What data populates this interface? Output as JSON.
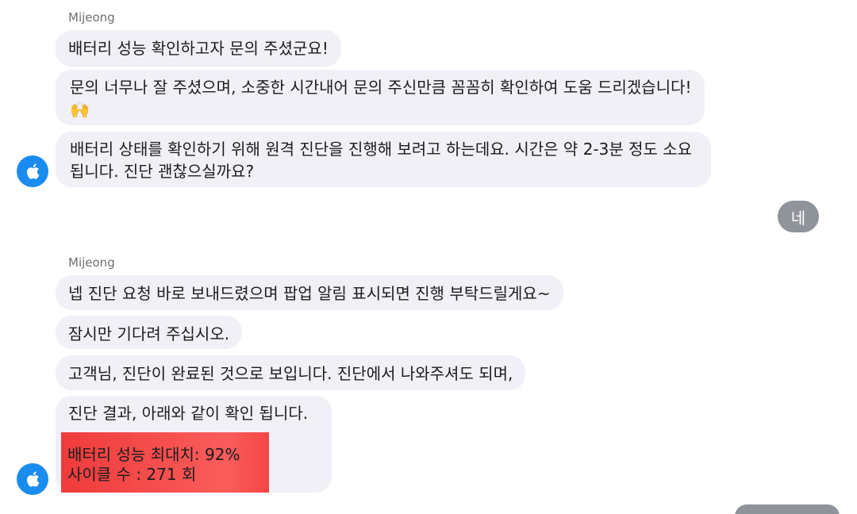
{
  "conversation": {
    "group1": {
      "sender": "Mijeong",
      "messages": [
        "배터리 성능 확인하고자 문의 주셨군요!",
        "문의 너무나 잘 주셨으며, 소중한 시간내어 문의 주신만큼 꼼꼼히 확인하여 도움 드리겠습니다! 🙌",
        "배터리 상태를 확인하기 위해 원격 진단을 진행해 보려고 하는데요. 시간은 약 2-3분 정도 소요됩니다. 진단 괜찮으실까요?"
      ]
    },
    "reply1": "네",
    "group2": {
      "sender": "Mijeong",
      "messages": [
        "넵 진단 요청 바로 보내드렸으며 팝업 알림 표시되면 진행 부탁드릴게요~",
        "잠시만 기다려 주십시오.",
        "고객님, 진단이 완료된 것으로 보입니다. 진단에서 나와주셔도 되며,",
        "진단 결과, 아래와 같이 확인 됩니다."
      ],
      "result": {
        "line1": "배터리 성능 최대치: 92%",
        "line2": "사이클 수 : 271 회"
      }
    }
  },
  "colors": {
    "agent_bubble": "#f1f0f7",
    "user_bubble": "#8e9499",
    "avatar": "#1a8cf0",
    "highlight": "#f54545"
  },
  "icons": {
    "avatar": "apple-logo-icon"
  }
}
